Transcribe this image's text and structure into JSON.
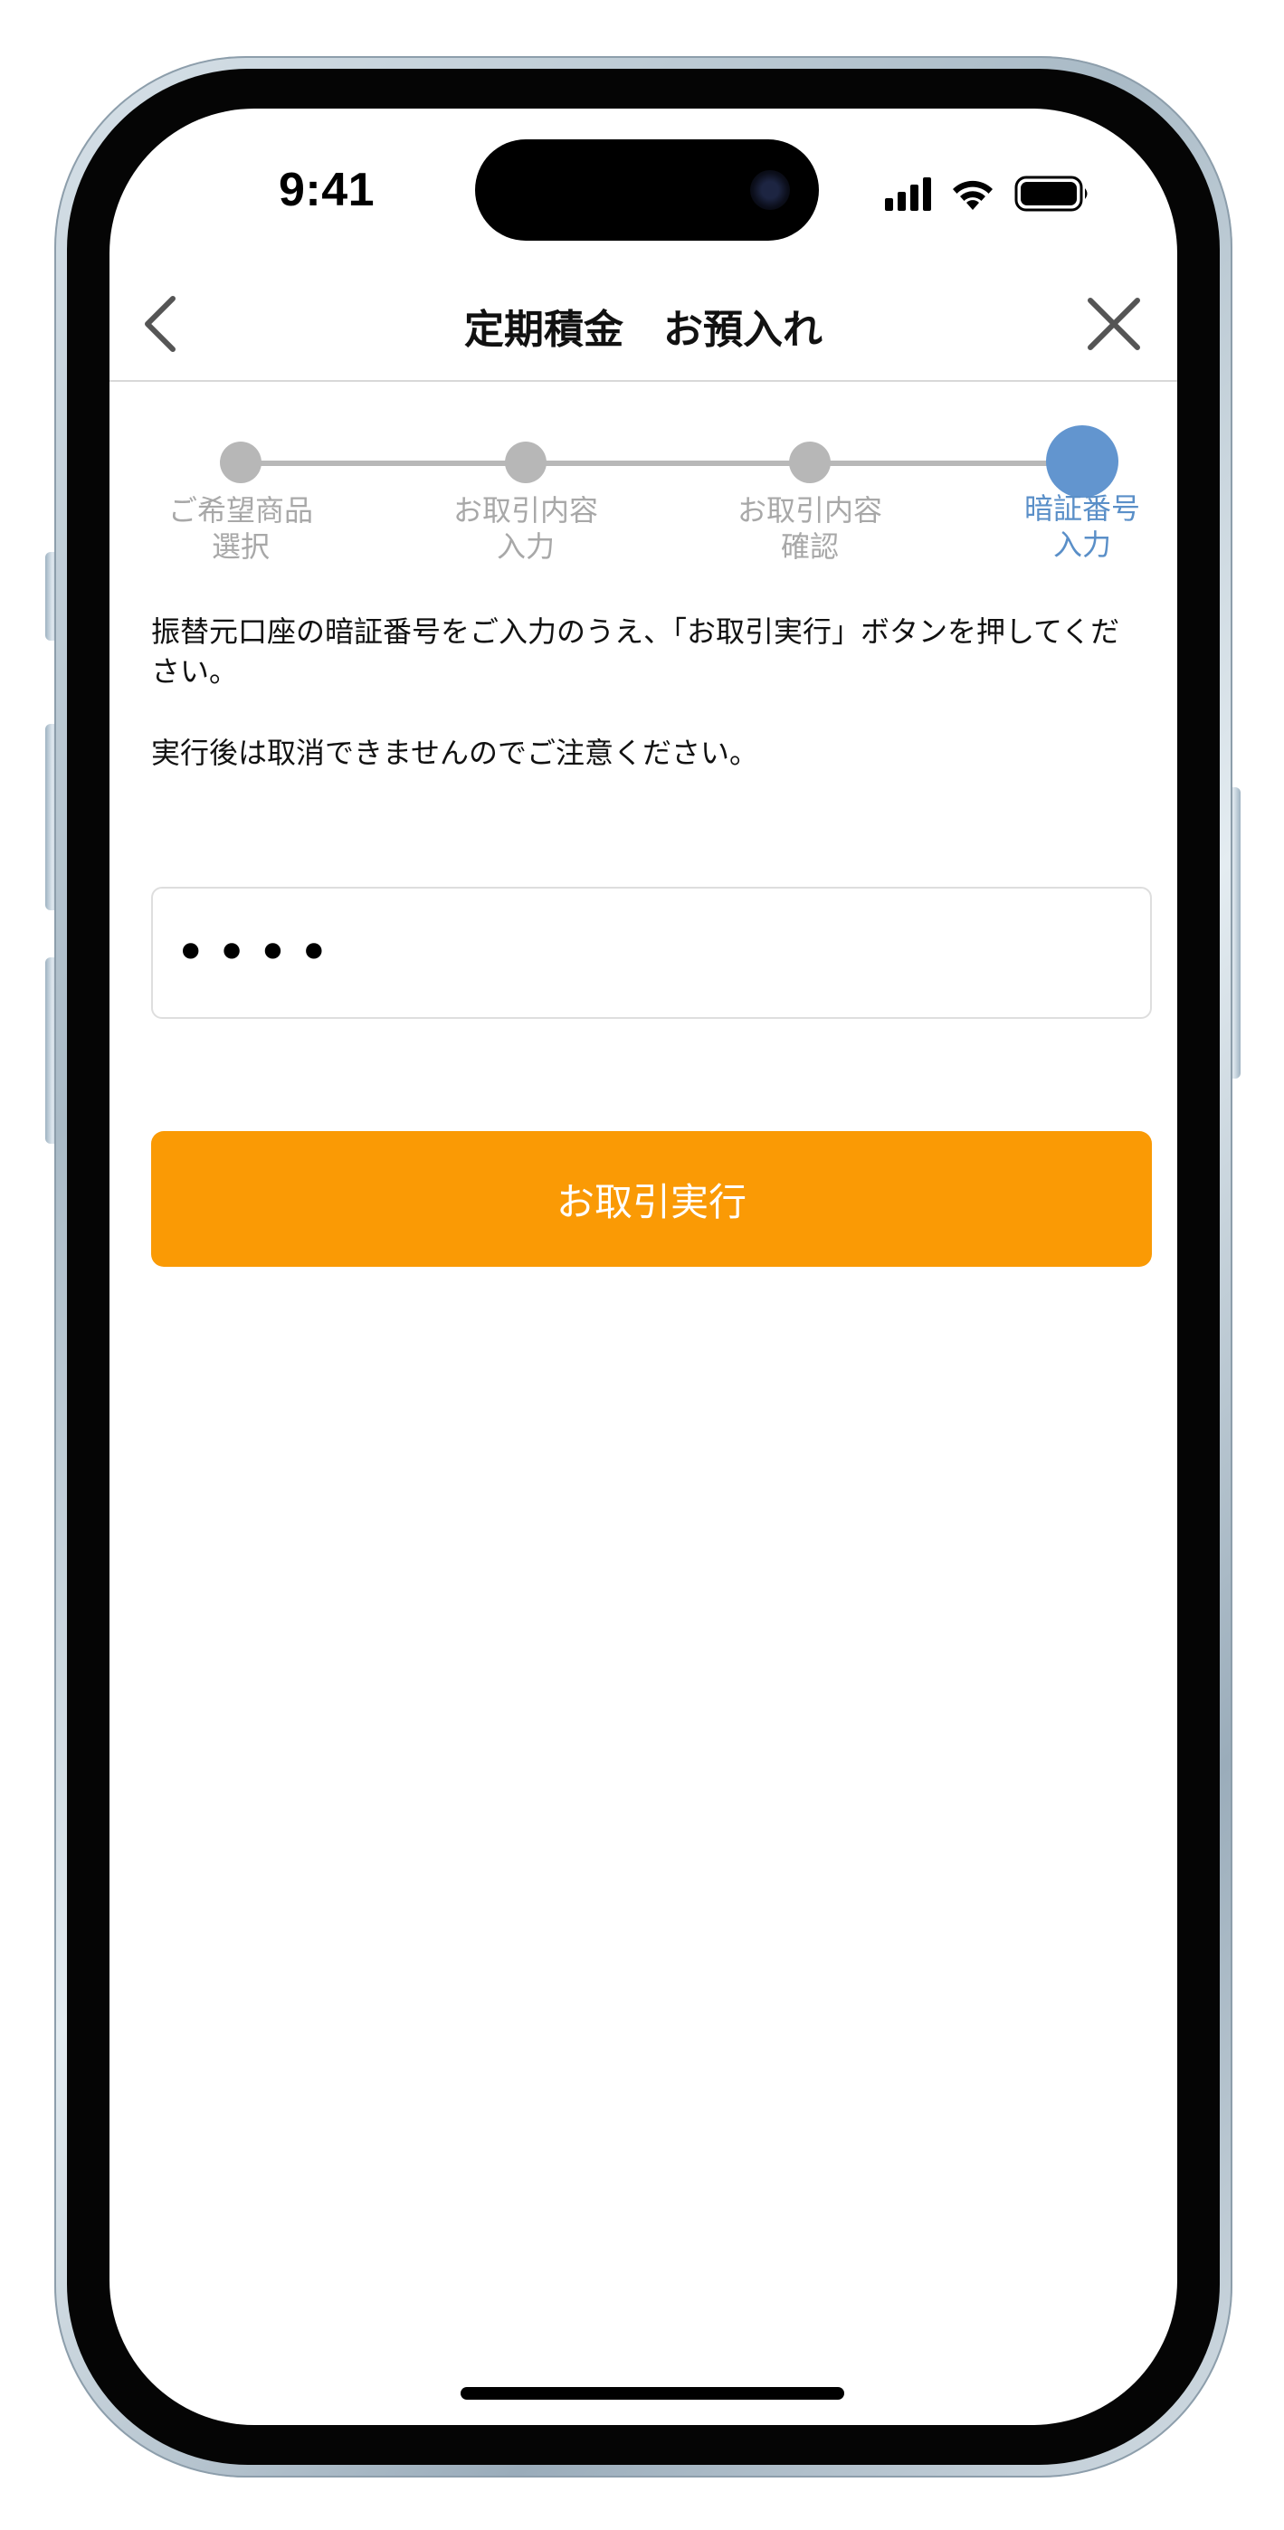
{
  "status_bar": {
    "time": "9:41",
    "icons": [
      "cellular-signal-icon",
      "wifi-icon",
      "battery-icon"
    ]
  },
  "nav": {
    "title": "定期積金　お預入れ",
    "back_icon": "chevron-left-icon",
    "close_icon": "close-icon"
  },
  "stepper": {
    "current_step": 4,
    "steps": [
      {
        "label_line1": "ご希望商品",
        "label_line2": "選択"
      },
      {
        "label_line1": "お取引内容",
        "label_line2": "入力"
      },
      {
        "label_line1": "お取引内容",
        "label_line2": "確認"
      },
      {
        "label_line1": "暗証番号",
        "label_line2": "入力"
      }
    ]
  },
  "content": {
    "instruction": "振替元口座の暗証番号をご入力のうえ、「お取引実行」ボタンを押してください。",
    "notice": "実行後は取消できませんのでご注意ください。"
  },
  "pin_input": {
    "value": "••••"
  },
  "execute_button": {
    "label": "お取引実行"
  },
  "colors": {
    "accent_orange": "#fa9a05",
    "step_active": "#6295cf",
    "step_inactive": "#b7b7b7"
  }
}
